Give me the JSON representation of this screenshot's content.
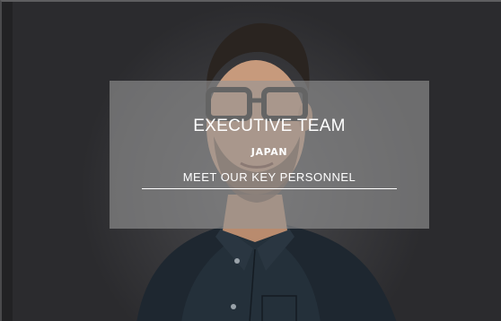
{
  "hero": {
    "title": "EXECUTIVE TEAM",
    "subtitle": "JAPAN",
    "link_label": "MEET OUR KEY PERSONNEL"
  },
  "colors": {
    "background": "#2b2b2e",
    "overlay": "#969696",
    "text": "#ffffff"
  }
}
